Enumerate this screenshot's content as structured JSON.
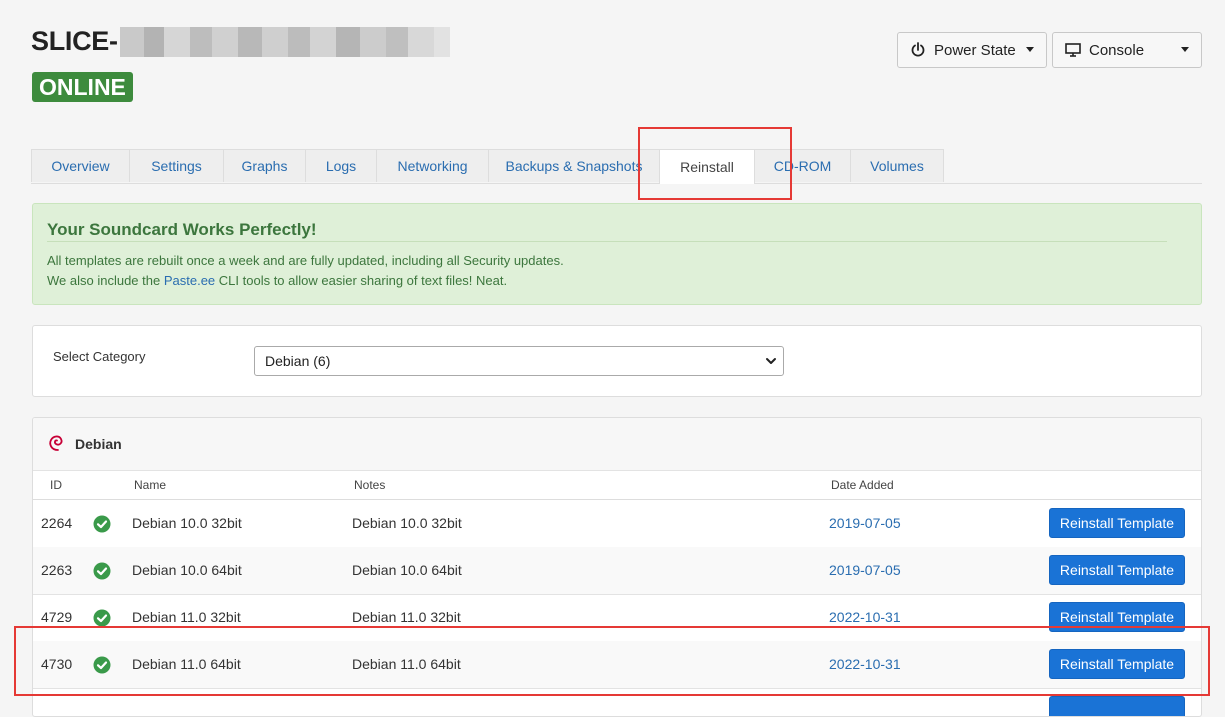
{
  "header": {
    "title": "SLICE-",
    "status": "ONLINE",
    "power_state_label": "Power State",
    "console_label": "Console"
  },
  "tabs": [
    "Overview",
    "Settings",
    "Graphs",
    "Logs",
    "Networking",
    "Backups & Snapshots",
    "Reinstall",
    "CD-ROM",
    "Volumes"
  ],
  "active_tab": "Reinstall",
  "alert": {
    "title": "Your Soundcard Works Perfectly!",
    "line1": "All templates are rebuilt once a week and are fully updated, including all Security updates.",
    "line2_before": "We also include the ",
    "line2_link": "Paste.ee",
    "line2_after": " CLI tools to allow easier sharing of text files! Neat."
  },
  "category": {
    "label": "Select Category",
    "selected": "Debian (6)"
  },
  "templates": {
    "heading": "Debian",
    "columns": {
      "id": "ID",
      "name": "Name",
      "notes": "Notes",
      "date": "Date Added"
    },
    "button_label": "Reinstall Template",
    "rows": [
      {
        "id": "2264",
        "name": "Debian 10.0 32bit",
        "notes": "Debian 10.0 32bit",
        "date": "2019-07-05"
      },
      {
        "id": "2263",
        "name": "Debian 10.0 64bit",
        "notes": "Debian 10.0 64bit",
        "date": "2019-07-05"
      },
      {
        "id": "4729",
        "name": "Debian 11.0 32bit",
        "notes": "Debian 11.0 32bit",
        "date": "2022-10-31"
      },
      {
        "id": "4730",
        "name": "Debian 11.0 64bit",
        "notes": "Debian 11.0 64bit",
        "date": "2022-10-31"
      }
    ]
  },
  "colors": {
    "online_badge": "#3d8b3d",
    "accent_link": "#2a6db0",
    "primary_button": "#1a73d6",
    "success_icon": "#3a9a4a",
    "highlight_box": "#e53935",
    "alert_bg": "#dff0d8"
  },
  "icons": {
    "power": "power-icon",
    "console": "monitor-icon",
    "debian": "debian-swirl-icon",
    "status_ok": "check-circle-icon"
  }
}
